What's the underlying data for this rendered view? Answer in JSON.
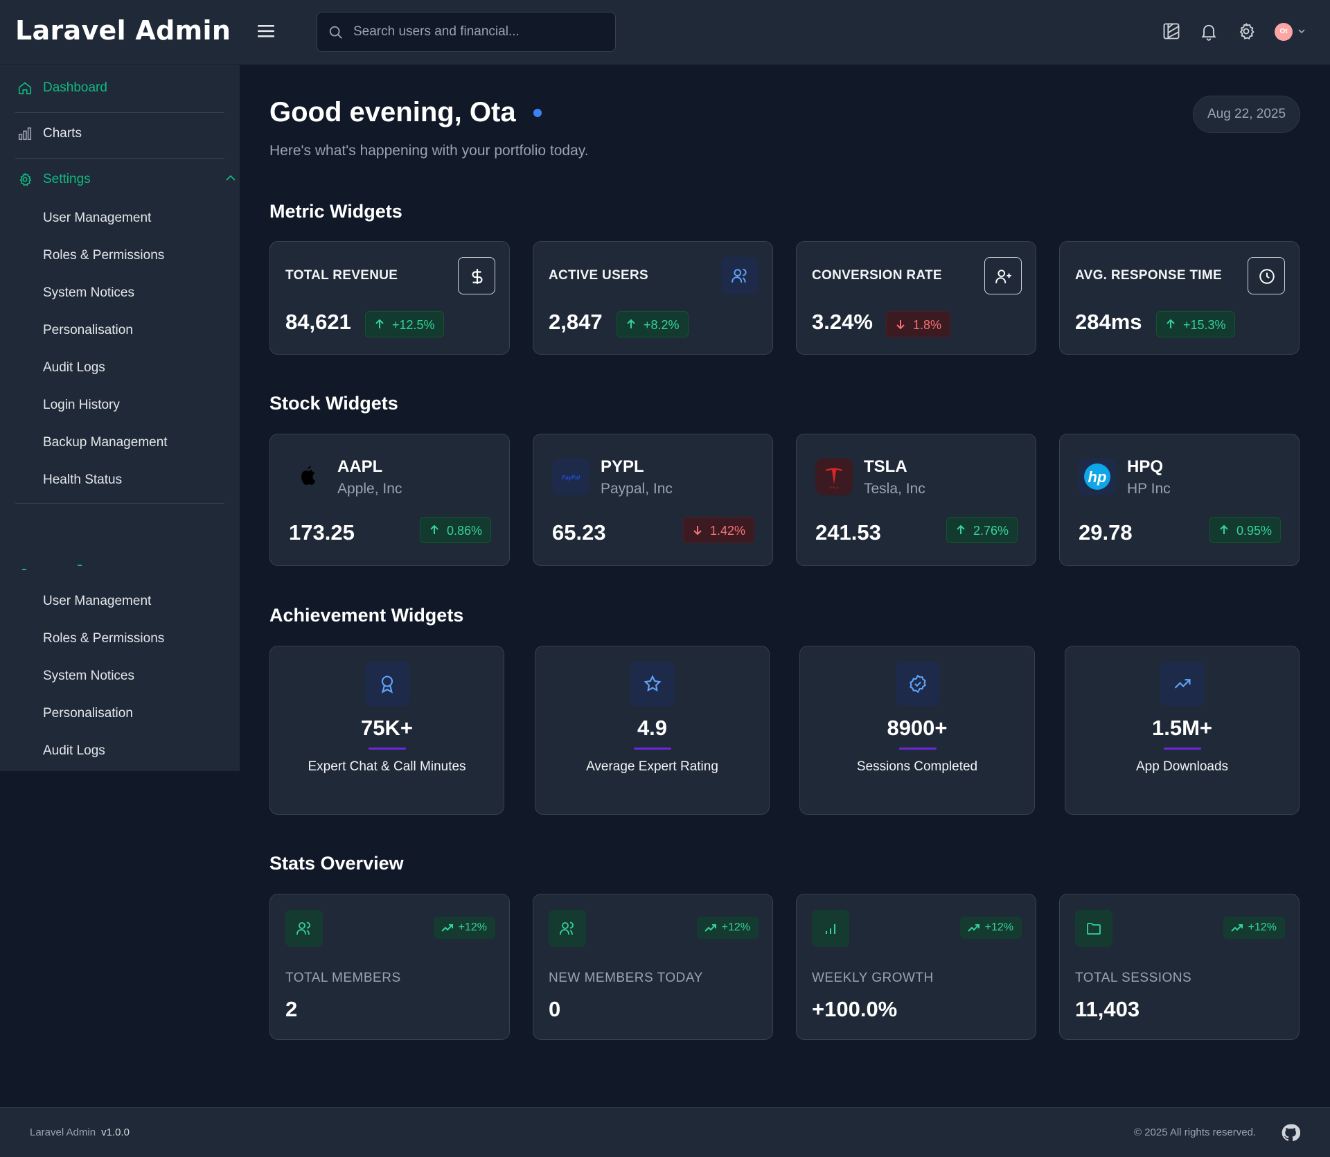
{
  "header": {
    "brand": "Laravel Admin",
    "search_placeholder": "Search users and financial...",
    "avatar_initials": "Ot"
  },
  "sidebar": {
    "dashboard": "Dashboard",
    "charts": "Charts",
    "settings": "Settings",
    "settings_items": [
      "User Management",
      "Roles & Permissions",
      "System Notices",
      "Personalisation",
      "Audit Logs",
      "Login History",
      "Backup Management",
      "Health Status"
    ],
    "second_items": [
      "User Management",
      "Roles & Permissions",
      "System Notices",
      "Personalisation",
      "Audit Logs"
    ]
  },
  "main": {
    "greeting": "Good evening,  Ota",
    "subtitle": "Here's what's happening with your portfolio today.",
    "date": "Aug 22, 2025",
    "sections": {
      "metric": "Metric Widgets",
      "stock": "Stock Widgets",
      "achievement": "Achievement Widgets",
      "stats": "Stats Overview"
    },
    "metrics": [
      {
        "label": "TOTAL REVENUE",
        "value": "84,621",
        "change": "+12.5%",
        "direction": "up",
        "icon": "dollar-icon"
      },
      {
        "label": "ACTIVE USERS",
        "value": "2,847",
        "change": "+8.2%",
        "direction": "up",
        "icon": "users-icon"
      },
      {
        "label": "CONVERSION RATE",
        "value": "3.24%",
        "change": "1.8%",
        "direction": "down",
        "icon": "user-plus-icon"
      },
      {
        "label": "AVG. RESPONSE TIME",
        "value": "284ms",
        "change": "+15.3%",
        "direction": "up",
        "icon": "clock-icon"
      }
    ],
    "stocks": [
      {
        "ticker": "AAPL",
        "name": "Apple, Inc",
        "price": "173.25",
        "change": "0.86%",
        "direction": "up",
        "icon": "apple-logo-icon"
      },
      {
        "ticker": "PYPL",
        "name": "Paypal, Inc",
        "price": "65.23",
        "change": "1.42%",
        "direction": "down",
        "icon": "paypal-logo-icon"
      },
      {
        "ticker": "TSLA",
        "name": "Tesla, Inc",
        "price": "241.53",
        "change": "2.76%",
        "direction": "up",
        "icon": "tesla-logo-icon"
      },
      {
        "ticker": "HPQ",
        "name": "HP Inc",
        "price": "29.78",
        "change": "0.95%",
        "direction": "up",
        "icon": "hp-logo-icon"
      }
    ],
    "achievements": [
      {
        "value": "75K+",
        "label": "Expert Chat & Call Minutes",
        "icon": "award-icon"
      },
      {
        "value": "4.9",
        "label": "Average Expert Rating",
        "icon": "star-icon"
      },
      {
        "value": "8900+",
        "label": "Sessions Completed",
        "icon": "badge-check-icon"
      },
      {
        "value": "1.5M+",
        "label": "App Downloads",
        "icon": "trending-up-icon"
      }
    ],
    "stats": [
      {
        "label": "TOTAL MEMBERS",
        "value": "2",
        "trend": "+12%",
        "icon": "users-icon"
      },
      {
        "label": "NEW MEMBERS TODAY",
        "value": "0",
        "trend": "+12%",
        "icon": "users-icon"
      },
      {
        "label": "WEEKLY GROWTH",
        "value": "+100.0%",
        "trend": "+12%",
        "icon": "bar-chart-icon"
      },
      {
        "label": "TOTAL SESSIONS",
        "value": "11,403",
        "trend": "+12%",
        "icon": "folder-icon"
      }
    ]
  },
  "footer": {
    "app": "Laravel Admin",
    "version": "v1.0.0",
    "copyright": "© 2025 All rights reserved."
  },
  "colors": {
    "accent_green": "#10b981",
    "accent_blue": "#3b82f6",
    "negative_red": "#f87171",
    "background": "#111827",
    "panel": "#1f2937"
  }
}
